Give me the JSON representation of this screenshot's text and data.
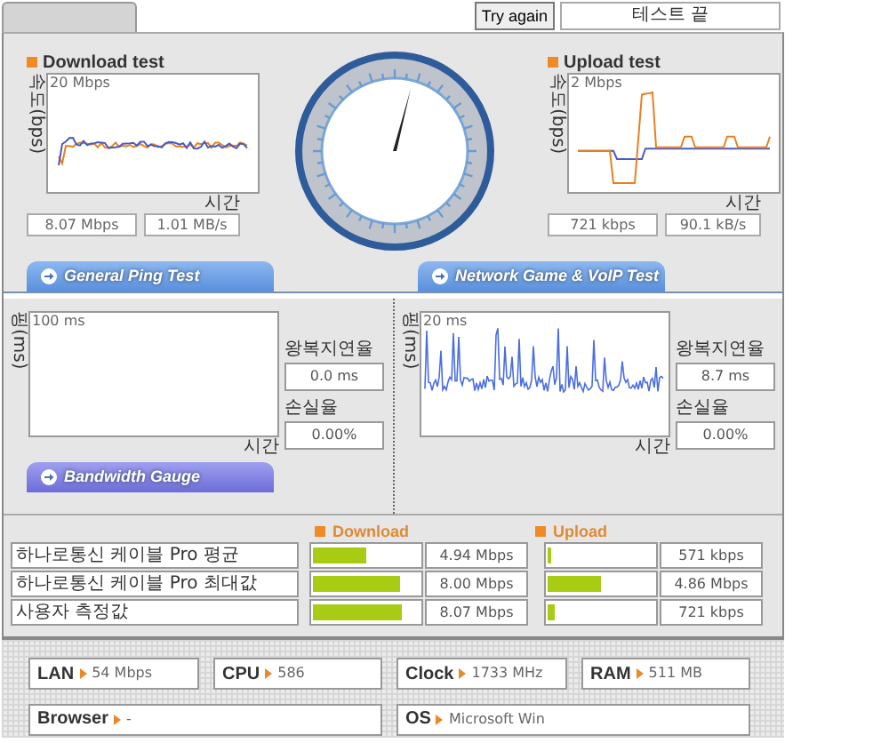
{
  "top_bar": {
    "try_again_button": "Try again",
    "status_field": "테스트 끝"
  },
  "speed_tests": [
    {
      "kind": "download",
      "title": "Download test",
      "y_axis": "속도(bps)",
      "scale_label": "20 Mbps",
      "x_axis": "시간",
      "readings": [
        "8.07 Mbps",
        "1.01 MB/s"
      ]
    },
    {
      "kind": "upload",
      "title": "Upload test",
      "y_axis": "속도(bps)",
      "scale_label": "2 Mbps",
      "x_axis": "시간",
      "readings": [
        "721 kbps",
        "90.1 kB/s"
      ]
    }
  ],
  "ping_tests": [
    {
      "kind": "empty",
      "tab": "General Ping Test",
      "y_axis": "핑(ms)",
      "scale_label": "100 ms",
      "x_axis": "시간",
      "latency_label": "왕복지연율",
      "latency": "0.0 ms",
      "loss_label": "손실율",
      "loss": "0.00%"
    },
    {
      "kind": "trace",
      "tab": "Network Game & VoIP Test",
      "y_axis": "핑(ms)",
      "scale_label": "20 ms",
      "x_axis": "시간",
      "latency_label": "왕복지연율",
      "latency": "8.7 ms",
      "loss_label": "손실율",
      "loss": "0.00%"
    }
  ],
  "bandwidth_gauge": {
    "tab": "Bandwidth Gauge",
    "download_header": "Download",
    "upload_header": "Upload",
    "rows": [
      {
        "label": "하나로통신 케이블 Pro 평균",
        "download": {
          "level": 0.5,
          "reading": "4.94 Mbps"
        },
        "upload": {
          "level": 0.04,
          "reading": "571 kbps"
        }
      },
      {
        "label": "하나로통신 케이블 Pro 최대값",
        "download": {
          "level": 0.82,
          "reading": "8.00 Mbps"
        },
        "upload": {
          "level": 0.5,
          "reading": "4.86 Mbps"
        }
      },
      {
        "label": "사용자 측정값",
        "download": {
          "level": 0.83,
          "reading": "8.07 Mbps"
        },
        "upload": {
          "level": 0.06,
          "reading": "721 kbps"
        }
      }
    ]
  },
  "system_info": [
    {
      "label": "LAN",
      "value": "54 Mbps"
    },
    {
      "label": "CPU",
      "value": "586"
    },
    {
      "label": "Clock",
      "value": "1733 MHz"
    },
    {
      "label": "RAM",
      "value": "511 MB"
    },
    {
      "label": "Browser",
      "value": "-"
    },
    {
      "label": "OS",
      "value": "Microsoft Win"
    }
  ]
}
